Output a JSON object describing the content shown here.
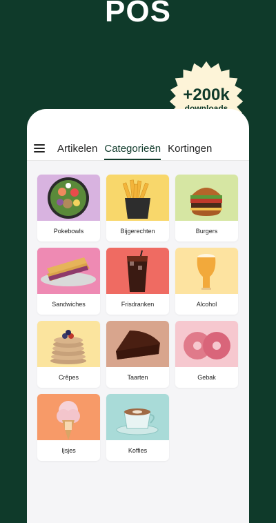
{
  "header": {
    "title": "POS"
  },
  "badge": {
    "main": "+200k",
    "sub": "downloads"
  },
  "tabs": [
    {
      "label": "Artikelen"
    },
    {
      "label": "Categorieën"
    },
    {
      "label": "Kortingen"
    }
  ],
  "categories": [
    {
      "label": "Pokebowls",
      "bg": "#d8b3e0"
    },
    {
      "label": "Bijgerechten",
      "bg": "#f8d76b"
    },
    {
      "label": "Burgers",
      "bg": "#d6e6a3"
    },
    {
      "label": "Sandwiches",
      "bg": "#ee8ab3"
    },
    {
      "label": "Frisdranken",
      "bg": "#ef6b62"
    },
    {
      "label": "Alcohol",
      "bg": "#fde3a0"
    },
    {
      "label": "Crêpes",
      "bg": "#fbe49e"
    },
    {
      "label": "Taarten",
      "bg": "#d8a58d"
    },
    {
      "label": "Gebak",
      "bg": "#f6c8cf"
    },
    {
      "label": "Ijsjes",
      "bg": "#f79a68"
    },
    {
      "label": "Koffies",
      "bg": "#a9dbd8"
    }
  ],
  "colors": {
    "background": "#0f3a2a",
    "accent": "#0f3a2a",
    "badge": "#fdf4d8"
  }
}
